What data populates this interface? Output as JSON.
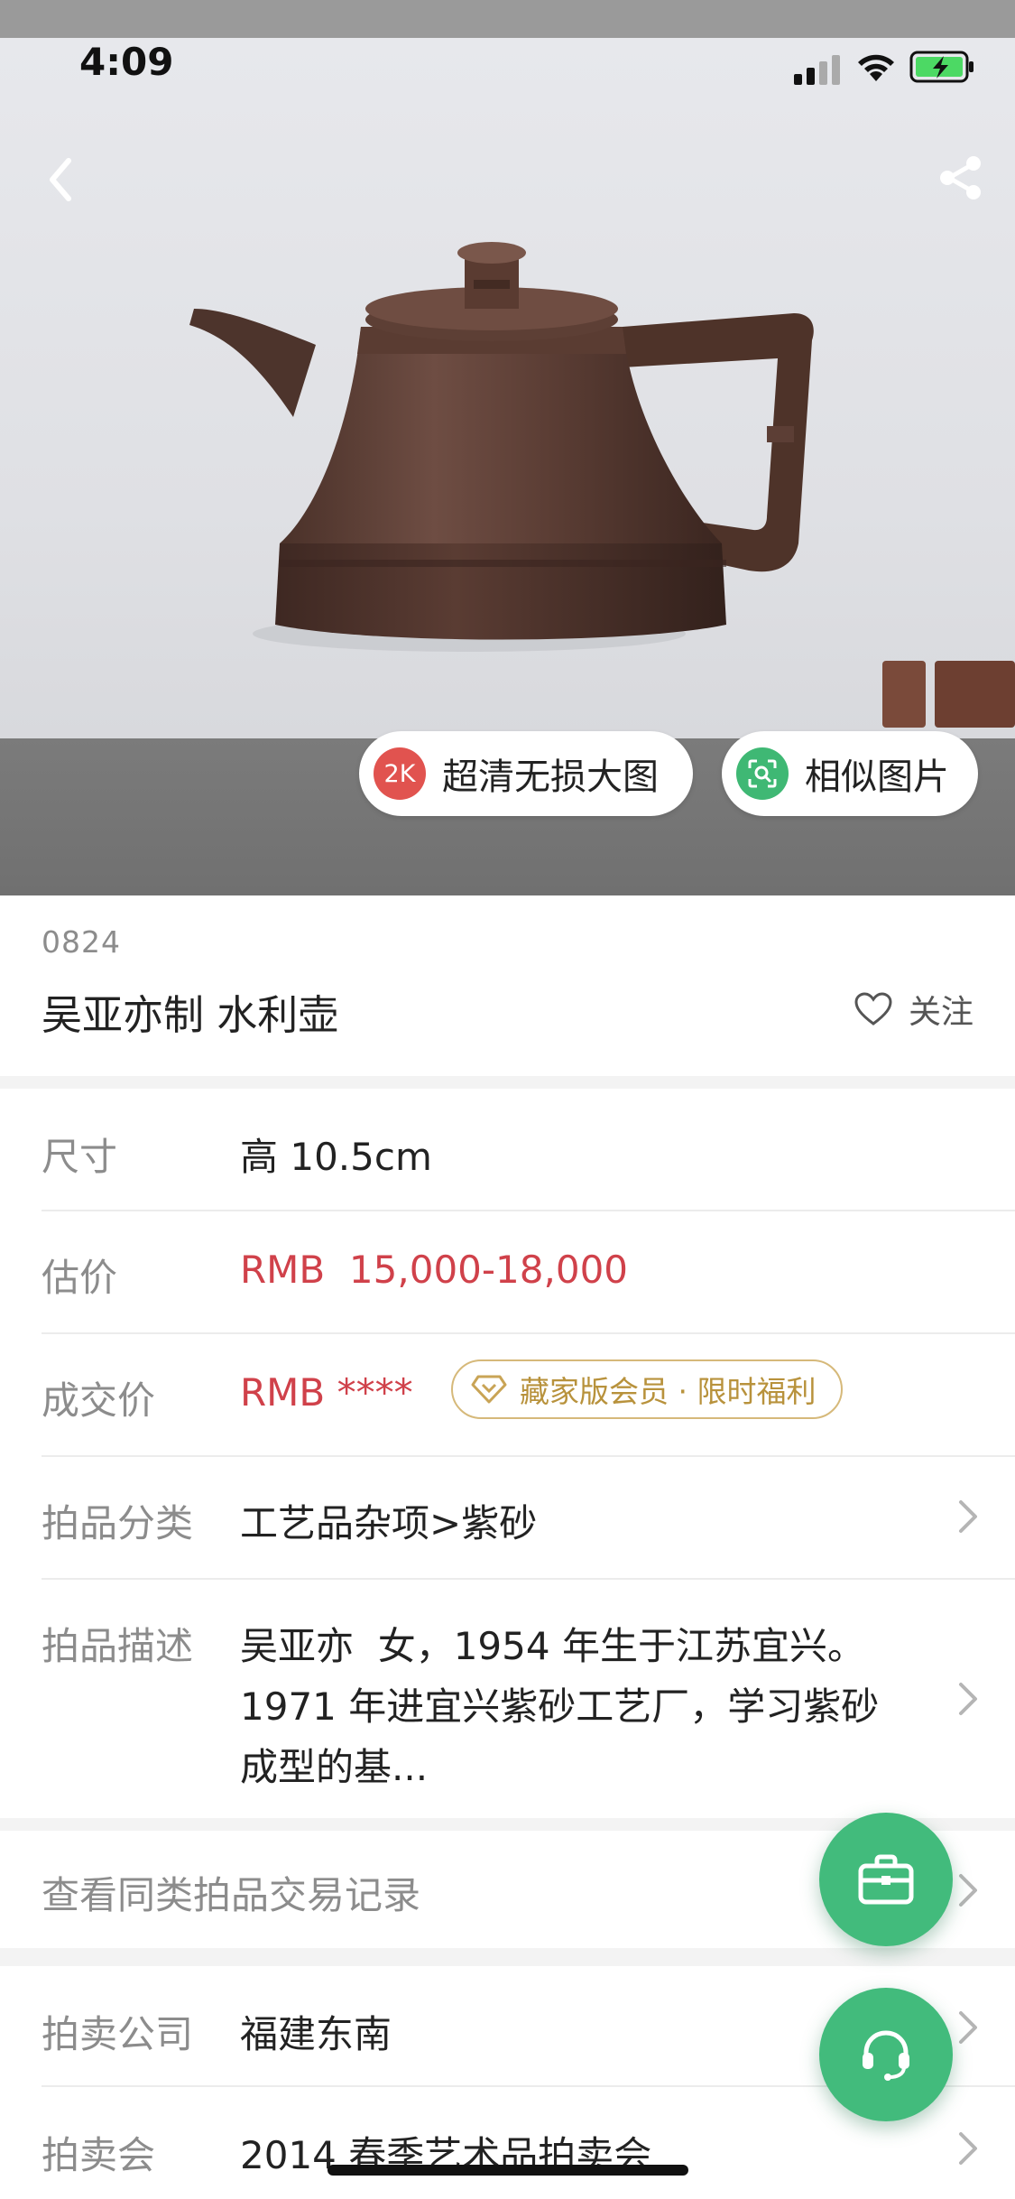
{
  "status_bar": {
    "time": "4:09"
  },
  "hero": {
    "hd_badge": "2K",
    "hd_label": "超清无损大图",
    "similar_label": "相似图片"
  },
  "item": {
    "lot_number": "0824",
    "title": "吴亚亦制 水利壶",
    "follow_label": "关注"
  },
  "details": {
    "size_label": "尺寸",
    "size_value": "高 10.5cm",
    "estimate_label": "估价",
    "estimate_value": "RMB  15,000-18,000",
    "deal_label": "成交价",
    "deal_value": "RMB ****",
    "vip_label": "藏家版会员 · 限时福利",
    "category_label": "拍品分类",
    "category_value": "工艺品杂项>紫砂",
    "desc_label": "拍品描述",
    "desc_lines": [
      "吴亚亦  女，1954 年生于江苏宜兴。",
      "1971 年进宜兴紫砂工艺厂，学习紫砂",
      "成型的基..."
    ]
  },
  "records": {
    "label": "查看同类拍品交易记录"
  },
  "auction": {
    "company_label": "拍卖公司",
    "company_value": "福建东南",
    "session_label": "拍卖会",
    "session_value": "2014 春季艺术品拍卖会"
  },
  "colors": {
    "accent_green": "#42bb7c",
    "price_red": "#d0414a",
    "vip_gold": "#b8923c"
  }
}
